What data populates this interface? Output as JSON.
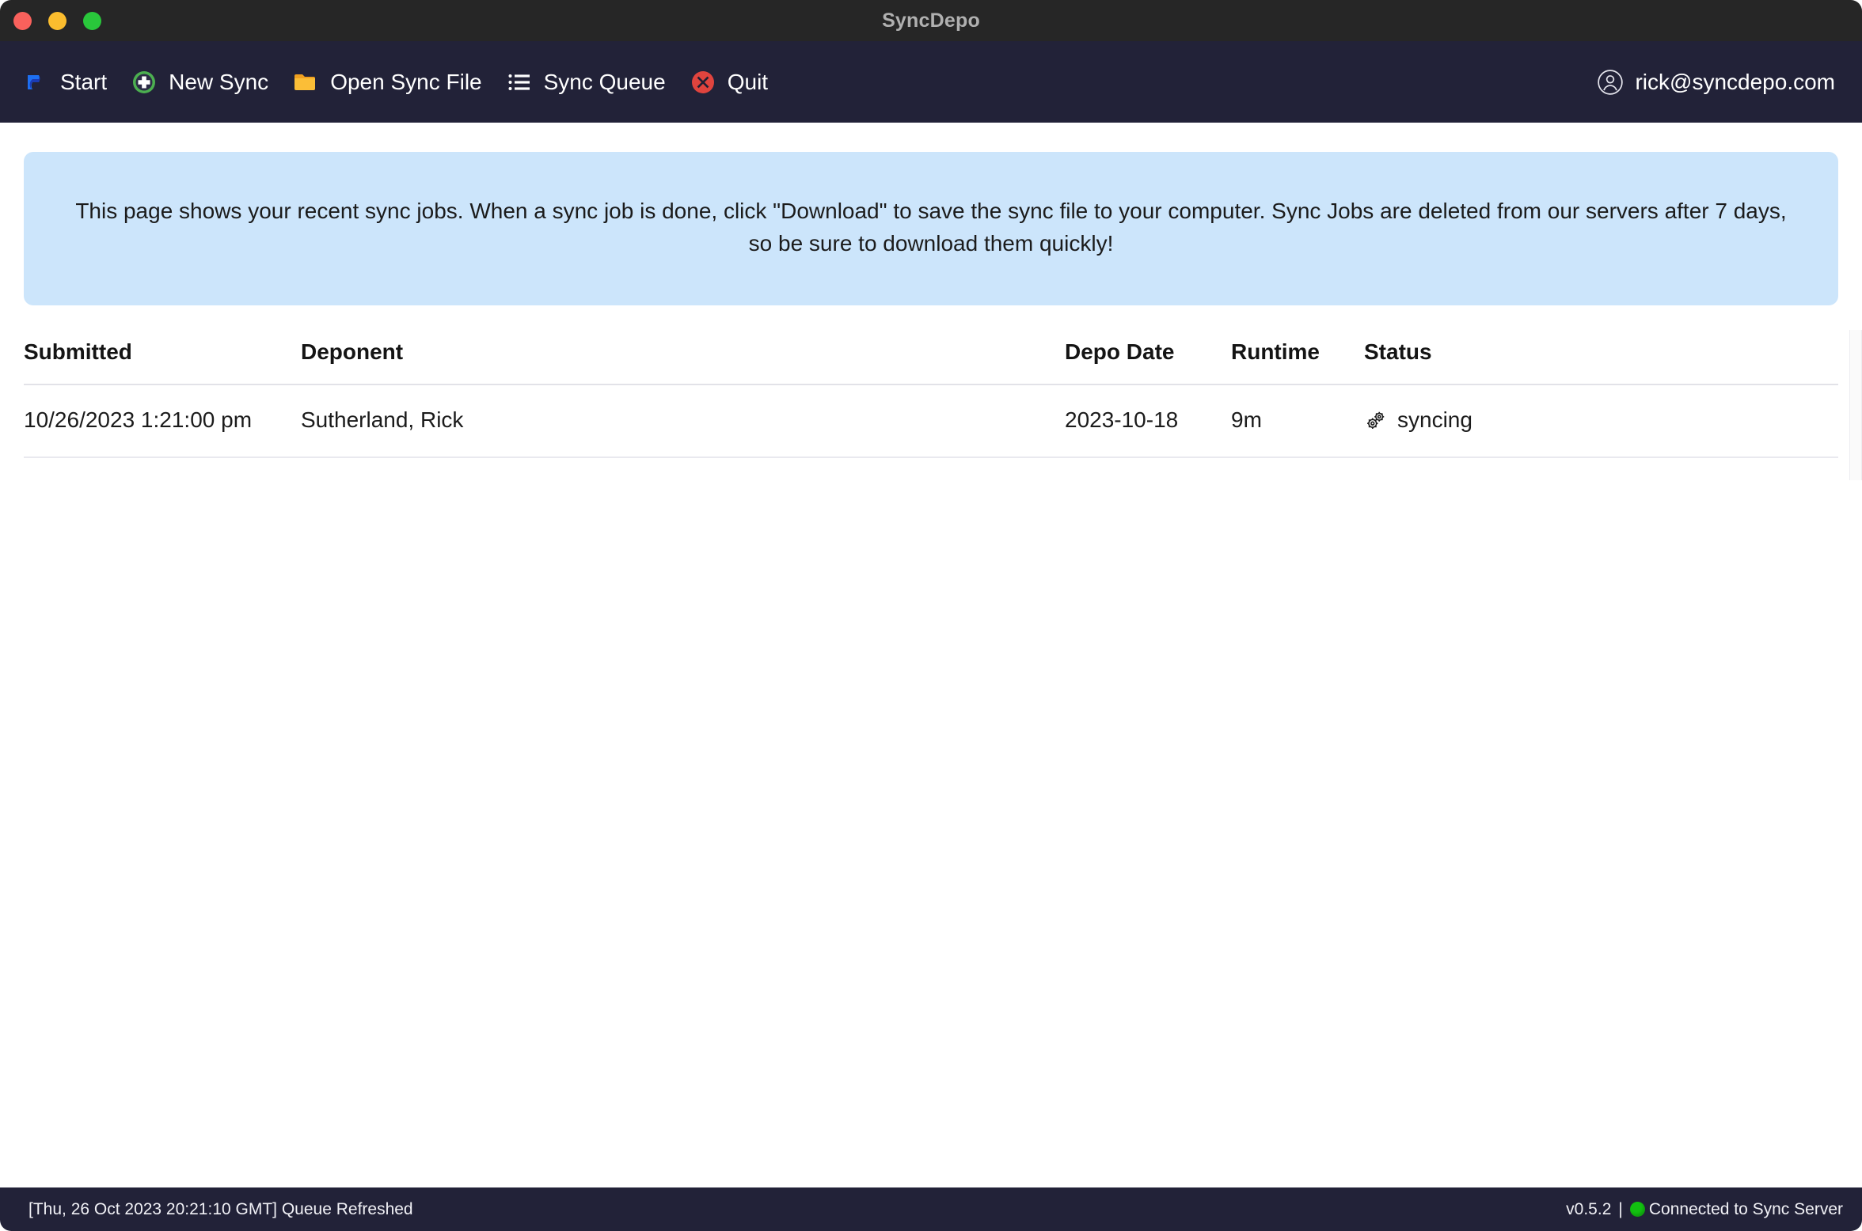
{
  "window": {
    "title": "SyncDepo",
    "controls": {
      "close": "close-window",
      "minimize": "minimize-window",
      "maximize": "maximize-window"
    }
  },
  "toolbar": {
    "items": [
      {
        "label": "Start",
        "icon": "syncdepo-logo-icon"
      },
      {
        "label": "New Sync",
        "icon": "plus-circle-icon"
      },
      {
        "label": "Open Sync File",
        "icon": "folder-icon"
      },
      {
        "label": "Sync Queue",
        "icon": "list-icon"
      },
      {
        "label": "Quit",
        "icon": "close-circle-icon"
      }
    ],
    "account": {
      "email": "rick@syncdepo.com",
      "icon": "account-circle-icon"
    }
  },
  "banner": {
    "text": "This page shows your recent sync jobs. When a sync job is done, click \"Download\" to save the sync file to your computer. Sync Jobs are deleted from our servers after 7 days, so be sure to download them quickly!",
    "background": "#cce5fb"
  },
  "table": {
    "columns": [
      "Submitted",
      "Deponent",
      "Depo Date",
      "Runtime",
      "Status",
      ""
    ],
    "rows": [
      {
        "submitted": "10/26/2023 1:21:00 pm",
        "deponent": "Sutherland, Rick",
        "depo_date": "2023-10-18",
        "runtime": "9m",
        "status": "syncing",
        "status_icon": "gears-icon",
        "action": ""
      }
    ]
  },
  "statusbar": {
    "log": "[Thu, 26 Oct 2023 20:21:10 GMT] Queue Refreshed",
    "version": "v0.5.2",
    "separator": "|",
    "connection": "Connected to Sync Server",
    "connection_color": "#12c010"
  },
  "colors": {
    "titlebar": "#262626",
    "toolbar": "#222238",
    "accent_blue": "#1d6ff2",
    "quit_red": "#e0443e",
    "new_sync_green": "#4caf50",
    "folder_yellow": "#fbbe37"
  }
}
